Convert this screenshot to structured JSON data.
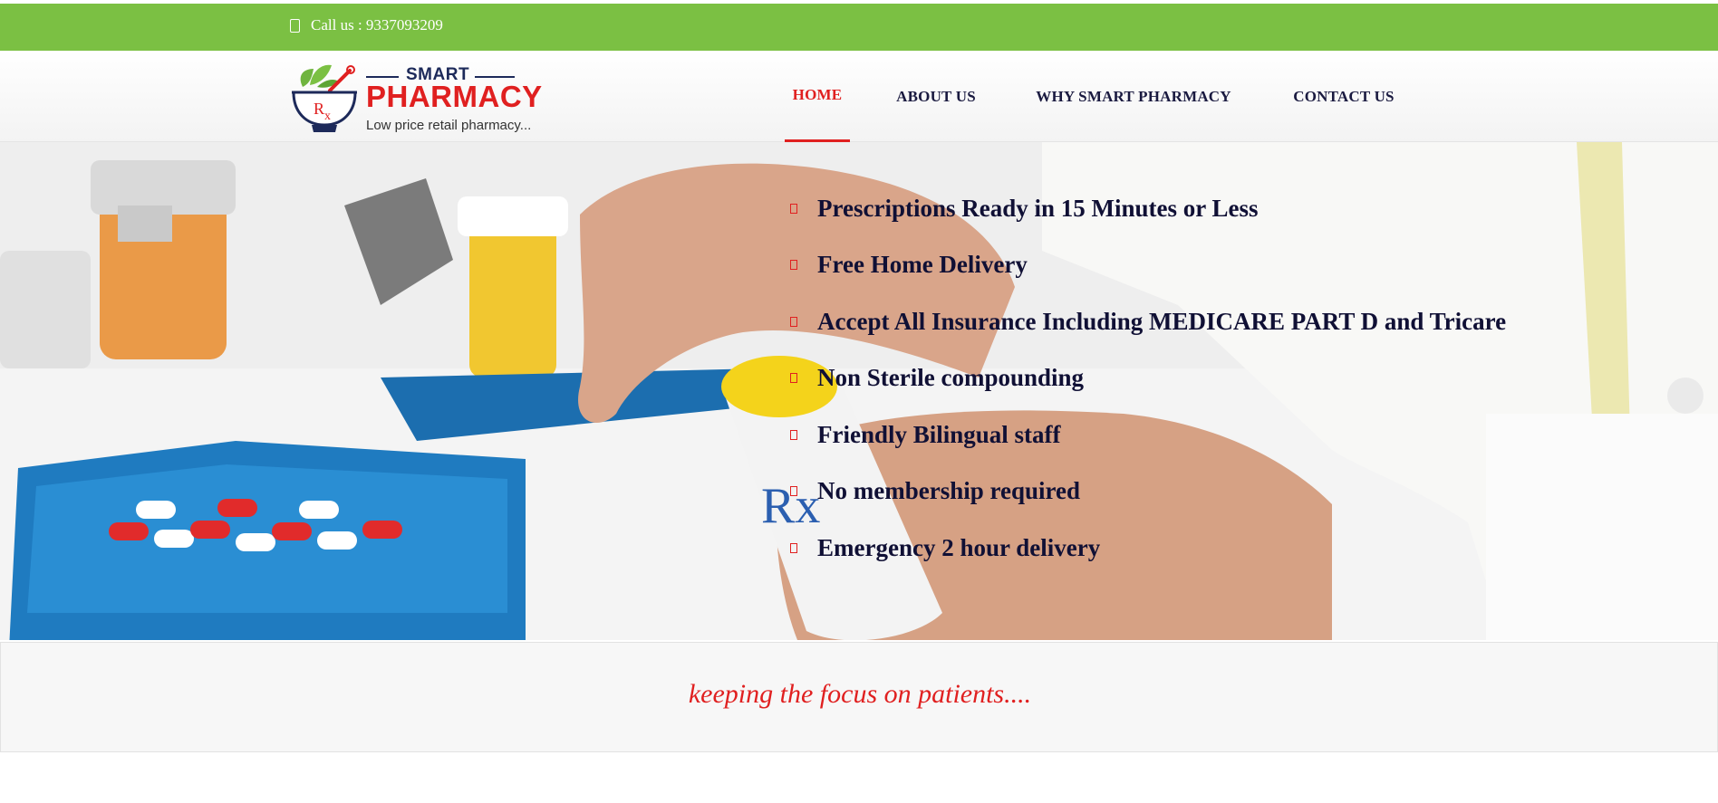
{
  "topbar": {
    "call_label": "Call us : 9337093209",
    "icon": "phone-icon",
    "background": "#7bc043"
  },
  "logo": {
    "smart": "SMART",
    "pharmacy": "PHARMACY",
    "tagline": "Low price retail pharmacy..."
  },
  "nav": {
    "items": [
      {
        "label": "HOME",
        "active": true
      },
      {
        "label": "ABOUT US",
        "active": false
      },
      {
        "label": "WHY SMART PHARMACY",
        "active": false
      },
      {
        "label": "CONTACT US",
        "active": false
      }
    ],
    "active_color": "#e02020"
  },
  "hero": {
    "features": [
      "Prescriptions Ready in 15 Minutes or Less",
      "Free Home Delivery",
      "Accept All Insurance Including MEDICARE PART D and Tricare",
      "Non Sterile compounding",
      "Friendly Bilingual staff",
      "No membership required",
      "Emergency 2 hour delivery"
    ],
    "bullet_icon": "file-icon"
  },
  "band": {
    "slogan": "keeping the focus on patients...."
  }
}
